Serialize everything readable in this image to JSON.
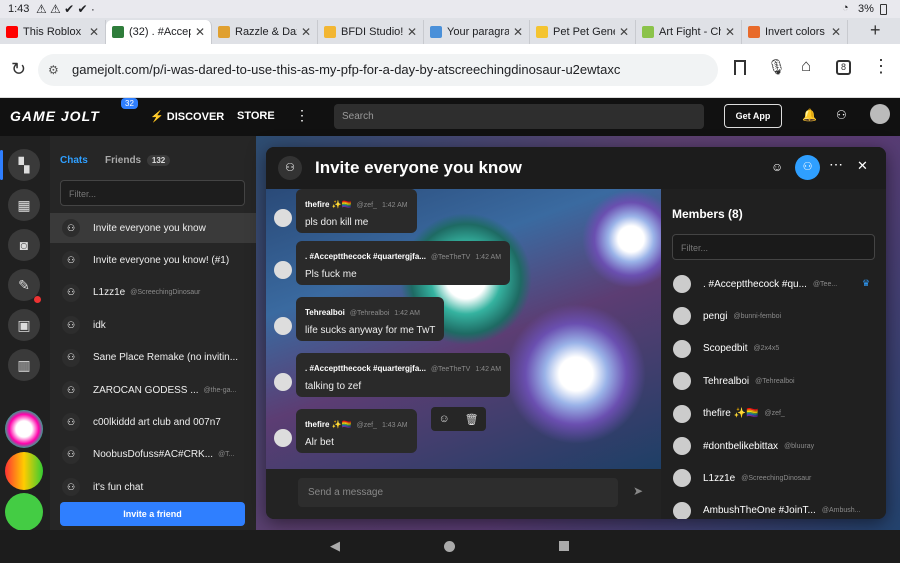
{
  "status": {
    "time": "1:43",
    "battery": "3%"
  },
  "tabs": [
    {
      "title": "This Roblox H",
      "fav": "#ff0000"
    },
    {
      "title": "(32) . #Accep",
      "fav": "#2f7d3b"
    },
    {
      "title": "Razzle & Dazz",
      "fav": "#e0a030"
    },
    {
      "title": "BFDI Studio! -",
      "fav": "#f2b632"
    },
    {
      "title": "Your paragrap",
      "fav": "#4a90d9"
    },
    {
      "title": "Pet Pet Gener",
      "fav": "#f4c430"
    },
    {
      "title": "Art Fight - Ch",
      "fav": "#8bc34a"
    },
    {
      "title": "Invert colors o",
      "fav": "#e86a2a"
    }
  ],
  "url": "gamejolt.com/p/i-was-dared-to-use-this-as-my-pfp-for-a-day-by-atscreechingdinosaur-u2ewtaxc",
  "tab_count": "8",
  "header": {
    "logo": "GAME JOLT",
    "notif_count": "32",
    "discover": "DISCOVER",
    "store": "STORE",
    "search_placeholder": "Search",
    "get_app": "Get App"
  },
  "chat_sidebar": {
    "tab_chats": "Chats",
    "tab_friends": "Friends",
    "friends_count": "132",
    "filter_placeholder": "Filter...",
    "invite_button": "Invite a friend",
    "items": [
      {
        "name": "Invite everyone you know",
        "sub": ""
      },
      {
        "name": "Invite everyone you know! (#1)",
        "sub": ""
      },
      {
        "name": "L1zz1e",
        "sub": "@ScreechingDinosaur"
      },
      {
        "name": "idk",
        "sub": ""
      },
      {
        "name": "Sane Place Remake (no invitin...",
        "sub": ""
      },
      {
        "name": "ZAROCAN GODESS ...",
        "sub": "@the-ga..."
      },
      {
        "name": "c00lkiddd art club and 007n7",
        "sub": ""
      },
      {
        "name": "NoobusDofuss#AC#CRK...",
        "sub": "@T..."
      },
      {
        "name": "it's fun chat",
        "sub": ""
      }
    ]
  },
  "modal": {
    "title": "Invite everyone you know",
    "composer_placeholder": "Send a message",
    "members_title": "Members (8)",
    "members_filter_placeholder": "Filter...",
    "messages": [
      {
        "name": "thefire ✨🏳️‍🌈",
        "handle": "@zef_",
        "time": "1:42 AM",
        "text": "pls don kill me"
      },
      {
        "name": ". #Acceptthecock #quartergjfa...",
        "handle": "@TeeTheTV",
        "time": "1:42 AM",
        "text": "Pls fuck me"
      },
      {
        "name": "Tehrealboi",
        "handle": "@Tehrealboi",
        "time": "1:42 AM",
        "text": "life sucks anyway for me TwT"
      },
      {
        "name": ". #Acceptthecock #quartergjfa...",
        "handle": "@TeeTheTV",
        "time": "1:42 AM",
        "text": "talking to zef"
      },
      {
        "name": "thefire ✨🏳️‍🌈",
        "handle": "@zef_",
        "time": "1:43 AM",
        "text": "Alr bet"
      }
    ],
    "members": [
      {
        "name": ". #Acceptthecock #qu...",
        "handle": "@Tee..."
      },
      {
        "name": "pengi",
        "handle": "@bunni-femboi"
      },
      {
        "name": "Scopedbit",
        "handle": "@2x4x5"
      },
      {
        "name": "Tehrealboi",
        "handle": "@Tehrealboi"
      },
      {
        "name": "thefire ✨🏳️‍🌈",
        "handle": "@zef_"
      },
      {
        "name": "#dontbelikebittax",
        "handle": "@bluuray"
      },
      {
        "name": "L1zz1e",
        "handle": "@ScreechingDinosaur"
      },
      {
        "name": "AmbushTheOne #JoinT...",
        "handle": "@Ambush..."
      }
    ]
  },
  "colors": {
    "accent": "#2f7fff",
    "invite_button": "#2f7fff",
    "online_dot": "#2aa8ff",
    "app_bg": "#191919"
  }
}
